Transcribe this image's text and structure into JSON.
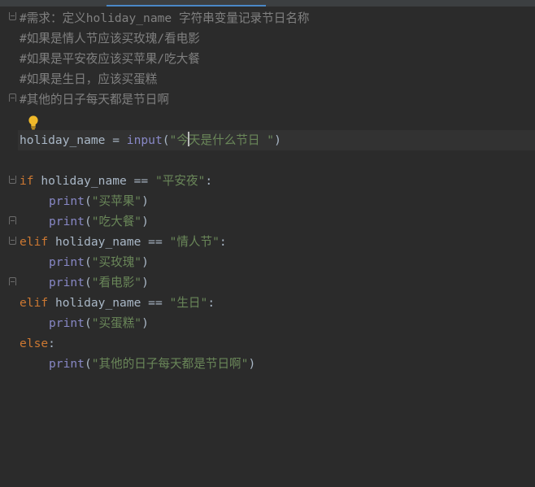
{
  "editor": {
    "comments": [
      "#需求：定义holiday_name 字符串变量记录节日名称",
      "#如果是情人节应该买玫瑰/看电影",
      "#如果是平安夜应该买苹果/吃大餐",
      "#如果是生日，应该买蛋糕",
      "#其他的日子每天都是节日啊"
    ],
    "assign": {
      "var": "holiday_name",
      "op": " = ",
      "func": "input",
      "open": "(",
      "str_before_caret": "\"今",
      "str_after_caret": "天是什么节日 \"",
      "close": ")"
    },
    "if_block": {
      "kw": "if",
      "var": "holiday_name",
      "op": " == ",
      "cond": "\"平安夜\"",
      "colon": ":",
      "body": [
        {
          "func": "print",
          "arg": "\"买苹果\""
        },
        {
          "func": "print",
          "arg": "\"吃大餐\""
        }
      ]
    },
    "elif1": {
      "kw": "elif",
      "var": "holiday_name",
      "op": " == ",
      "cond": "\"情人节\"",
      "colon": ":",
      "body": [
        {
          "func": "print",
          "arg": "\"买玫瑰\""
        },
        {
          "func": "print",
          "arg": "\"看电影\""
        }
      ]
    },
    "elif2": {
      "kw": "elif",
      "var": "holiday_name",
      "op": " == ",
      "cond": "\"生日\"",
      "colon": ":",
      "body": [
        {
          "func": "print",
          "arg": "\"买蛋糕\""
        }
      ]
    },
    "else_block": {
      "kw": "else",
      "colon": ":",
      "body": [
        {
          "func": "print",
          "arg": "\"其他的日子每天都是节日啊\""
        }
      ]
    },
    "paren_open": "(",
    "paren_close": ")"
  },
  "colors": {
    "background": "#2b2b2b",
    "comment": "#808080",
    "keyword": "#cc7832",
    "builtin": "#8888c6",
    "string": "#6a8759",
    "text": "#a9b7c6",
    "current_line": "#323232",
    "tab_underline": "#4a88c7"
  },
  "icons": {
    "intention": "lightbulb-icon",
    "fold": "fold-marker-icon"
  }
}
